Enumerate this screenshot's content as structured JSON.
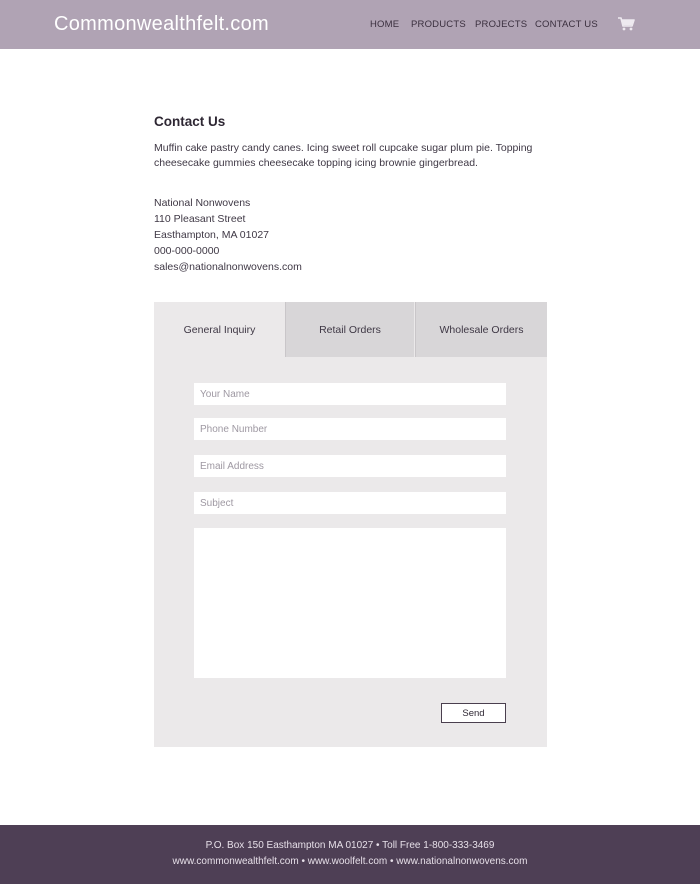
{
  "header": {
    "logo": "Commonwealthfelt.com",
    "nav": [
      "HOME",
      "PRODUCTS",
      "PROJECTS",
      "CONTACT US"
    ],
    "cart_icon": "shopping-cart-icon",
    "background_color": "#b0a3b4"
  },
  "main": {
    "title": "Contact Us",
    "intro": "Muffin cake pastry candy canes. Icing sweet roll cupcake sugar plum pie. Topping cheesecake gummies cheesecake topping icing brownie gingerbread.",
    "address": {
      "company": "National Nonwovens",
      "street": "110 Pleasant Street",
      "city": "Easthampton, MA 01027",
      "phone": "000-000-0000",
      "email": "sales@nationalnonwovens.com"
    }
  },
  "form": {
    "tabs": [
      "General Inquiry",
      "Retail Orders",
      "Wholesale Orders"
    ],
    "active_tab": "General Inquiry",
    "fields": {
      "name_placeholder": "Your Name",
      "phone_placeholder": "Phone Number",
      "email_placeholder": "Email Address",
      "subject_placeholder": "Subject",
      "message_value": ""
    },
    "send_label": "Send"
  },
  "footer": {
    "line1": "P.O. Box 150 Easthampton MA 01027 • Toll Free 1-800-333-3469",
    "line2": "www.commonwealthfelt.com • www.woolfelt.com • www.nationalnonwovens.com",
    "background_color": "#4e3f55"
  }
}
